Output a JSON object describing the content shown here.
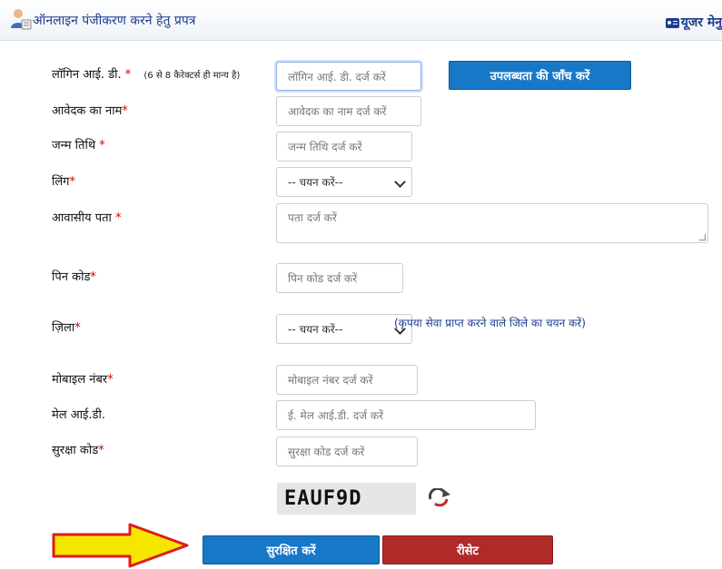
{
  "header": {
    "title": "ऑनलाइन पंजीकरण करने हेतु प्रपत्र",
    "user_menu": "यूजर मेनु"
  },
  "form": {
    "login_id": {
      "label": "लॉगिन आई. डी.",
      "req": "*",
      "hint": "(6 से 8 कैरेक्टर्स ही मान्य है)",
      "placeholder": "लॉगिन आई. डी. दर्ज करें"
    },
    "check_button": "उपलब्धता की जाँच करें",
    "applicant_name": {
      "label": "आवेदक का नाम",
      "req": "*",
      "placeholder": "आवेदक का नाम दर्ज करें"
    },
    "dob": {
      "label": "जन्म तिथि",
      "req": "*",
      "placeholder": "जन्म तिथि दर्ज करें"
    },
    "gender": {
      "label": "लिंग",
      "req": "*",
      "selected": "-- चयन करें--"
    },
    "address": {
      "label": "आवासीय पता",
      "req": "*",
      "placeholder": "पता दर्ज करें"
    },
    "pin": {
      "label": "पिन कोड",
      "req": "*",
      "placeholder": "पिन कोड दर्ज करें"
    },
    "district": {
      "label": "ज़िला",
      "req": "*",
      "selected": "-- चयन करें--",
      "note": "(कृपया सेवा प्राप्त करने वाले जिले का चयन करें)"
    },
    "mobile": {
      "label": "मोबाइल नंबर",
      "req": "*",
      "placeholder": "मोबाइल नंबर दर्ज करें"
    },
    "email": {
      "label": "मेल आई.डी.",
      "placeholder": "ई. मेल आई.डी. दर्ज करें"
    },
    "security": {
      "label": "सुरक्षा कोड",
      "req": "*",
      "placeholder": "सुरक्षा कोड  दर्ज करें"
    },
    "captcha": "EAUF9D",
    "save_button": "सुरक्षित करें",
    "reset_button": "रीसेट"
  },
  "colors": {
    "primary_button": "#1778c7",
    "reset_button": "#b02a2a",
    "required": "#d40000",
    "arrow_fill": "#f5e600",
    "arrow_stroke": "#e01b1b"
  }
}
